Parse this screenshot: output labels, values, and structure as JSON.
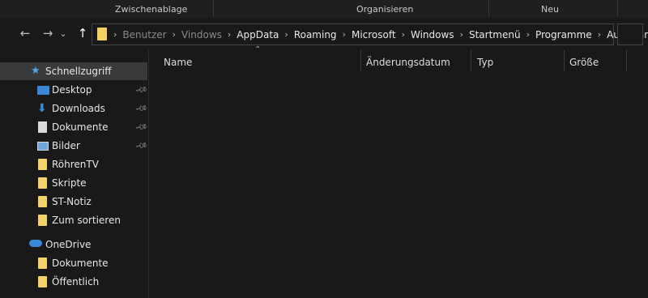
{
  "ribbon": {
    "groups": [
      "Zwischenablage",
      "Organisieren",
      "Neu"
    ]
  },
  "nav": {
    "back": "←",
    "forward": "→",
    "recent": "⌄",
    "up": "↑"
  },
  "address": {
    "breadcrumbs": [
      "Benutzer",
      "Vindows",
      "AppData",
      "Roaming",
      "Microsoft",
      "Windows",
      "Startmenü",
      "Programme",
      "Autostart"
    ],
    "separator": "›"
  },
  "sidebar": {
    "items": [
      {
        "label": "Schnellzugriff",
        "icon": "star-icon"
      },
      {
        "label": "Desktop",
        "icon": "desktop-icon",
        "pinned": true
      },
      {
        "label": "Downloads",
        "icon": "download-icon",
        "pinned": true
      },
      {
        "label": "Dokumente",
        "icon": "document-icon",
        "pinned": true
      },
      {
        "label": "Bilder",
        "icon": "pictures-icon",
        "pinned": true
      },
      {
        "label": "RöhrenTV",
        "icon": "folder-icon"
      },
      {
        "label": "Skripte",
        "icon": "folder-icon"
      },
      {
        "label": "ST-Notiz",
        "icon": "folder-icon"
      },
      {
        "label": "Zum sortieren",
        "icon": "folder-icon"
      },
      {
        "label": "OneDrive",
        "icon": "cloud-icon"
      },
      {
        "label": "Dokumente",
        "icon": "folder-icon"
      },
      {
        "label": "Öffentlich",
        "icon": "folder-icon"
      }
    ]
  },
  "columns": [
    "Name",
    "Änderungsdatum",
    "Typ",
    "Größe"
  ],
  "colors": {
    "background": "#191919",
    "selected": "#3a3a3a",
    "folder": "#f5d36a",
    "accent_blue": "#3b86d6"
  }
}
